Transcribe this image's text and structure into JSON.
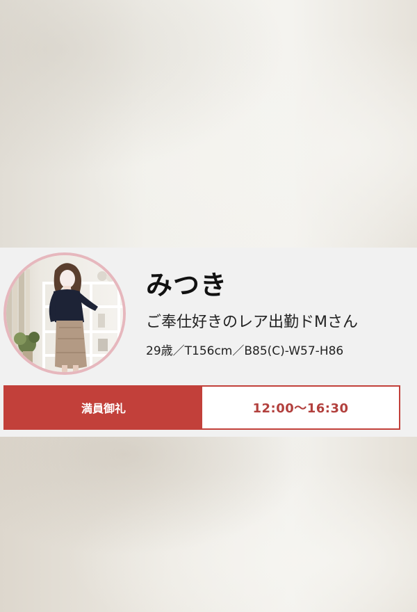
{
  "profile": {
    "name": "みつき",
    "catchphrase": "ご奉仕好きのレア出勤ドMさん",
    "specs": "29歳／T156cm／B85(C)-W57-H86",
    "avatar_icon": "profile-photo",
    "avatar_border_color": "#e6b7bd"
  },
  "schedule": {
    "status_label": "満員御礼",
    "time": "12:00〜16:30",
    "accent_color": "#c2403a"
  }
}
